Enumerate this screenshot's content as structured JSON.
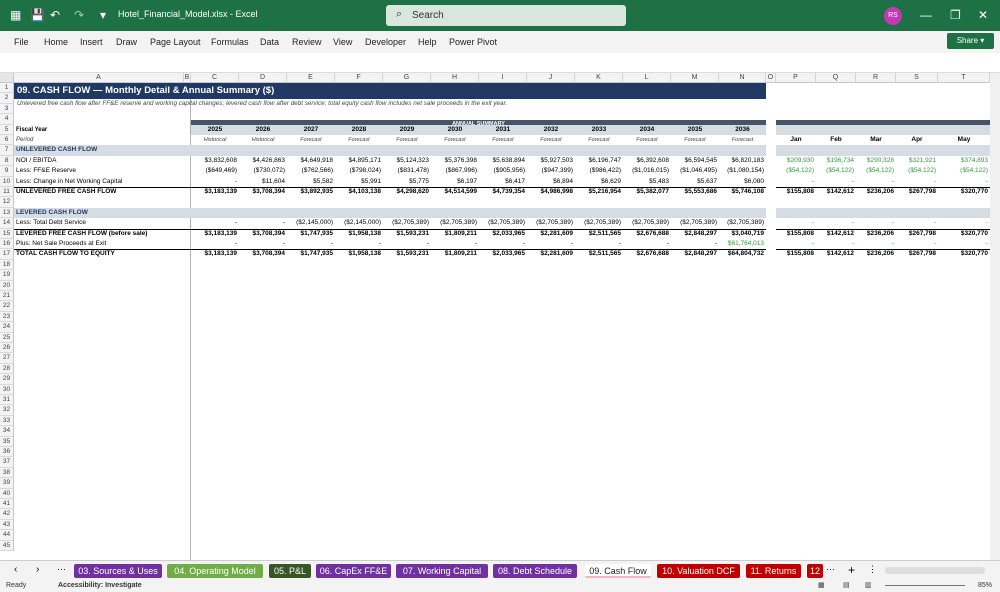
{
  "window": {
    "file_title": "Hotel_Financial_Model.xlsx  -  Excel",
    "search_placeholder": "Search",
    "avatar_initials": "RS"
  },
  "ribbon": {
    "menus": [
      "File",
      "Home",
      "Insert",
      "Draw",
      "Page Layout",
      "Formulas",
      "Data",
      "Review",
      "View",
      "Developer",
      "Help",
      "Power Pivot"
    ],
    "share_label": "Share"
  },
  "columns": [
    "A",
    "B",
    "C",
    "D",
    "E",
    "F",
    "G",
    "H",
    "I",
    "J",
    "K",
    "L",
    "M",
    "N",
    "O",
    "P",
    "Q",
    "R",
    "S",
    "T"
  ],
  "rows": [
    "1",
    "2",
    "3",
    "4",
    "5",
    "6",
    "7",
    "8",
    "9",
    "10",
    "11",
    "12",
    "13",
    "14",
    "15",
    "16",
    "17",
    "18",
    "19",
    "20",
    "21",
    "22",
    "23",
    "24",
    "25",
    "26",
    "27",
    "28",
    "29",
    "30",
    "31",
    "32",
    "33",
    "34",
    "35",
    "36",
    "37",
    "38",
    "39",
    "40",
    "41",
    "42",
    "43",
    "44",
    "45"
  ],
  "sheet": {
    "title": "09. CASH FLOW — Monthly Detail & Annual Summary ($)",
    "subtitle": "Unlevered free cash flow after FF&E reserve and working capital changes; levered cash flow after debt service; total equity cash flow includes net sale proceeds in the exit year.",
    "annual_summary_label": "ANNUAL SUMMARY",
    "fiscal_year_label": "Fiscal Year",
    "period_label": "Period",
    "years": [
      "2025",
      "2026",
      "2027",
      "2028",
      "2029",
      "2030",
      "2031",
      "2032",
      "2033",
      "2034",
      "2035",
      "2036"
    ],
    "periods": [
      "Historical",
      "Historical",
      "Forecast",
      "Forecast",
      "Forecast",
      "Forecast",
      "Forecast",
      "Forecast",
      "Forecast",
      "Forecast",
      "Forecast",
      "Forecast"
    ],
    "months": [
      "Jan",
      "Feb",
      "Mar",
      "Apr",
      "May"
    ],
    "section_unlevered": "UNLEVERED CASH FLOW",
    "section_levered": "LEVERED CASH FLOW",
    "lines": [
      {
        "row": 8,
        "label": "NOI / EBITDA",
        "bold": false,
        "values": [
          "$3,832,608",
          "$4,426,863",
          "$4,649,918",
          "$4,895,171",
          "$5,124,323",
          "$5,376,398",
          "$5,638,894",
          "$5,927,503",
          "$6,196,747",
          "$6,392,608",
          "$6,594,545",
          "$6,820,183"
        ],
        "monthly": [
          "$209,930",
          "$196,734",
          "$290,328",
          "$321,921",
          "$374,893"
        ]
      },
      {
        "row": 9,
        "label": "Less: FF&E Reserve",
        "bold": false,
        "values": [
          "($649,469)",
          "($730,072)",
          "($762,566)",
          "($798,024)",
          "($831,478)",
          "($867,996)",
          "($905,956)",
          "($947,399)",
          "($986,422)",
          "($1,016,015)",
          "($1,046,495)",
          "($1,080,154)"
        ],
        "monthly": [
          "($54,122)",
          "($54,122)",
          "($54,122)",
          "($54,122)",
          "($54,122)"
        ]
      },
      {
        "row": 10,
        "label": "Less: Change in Net Working Capital",
        "bold": false,
        "values": [
          "-",
          "$11,604",
          "$5,582",
          "$5,991",
          "$5,775",
          "$6,197",
          "$6,417",
          "$6,894",
          "$6,629",
          "$5,483",
          "$5,637",
          "$6,080"
        ],
        "monthly": [
          "-",
          "-",
          "-",
          "-",
          "-"
        ]
      },
      {
        "row": 11,
        "label": "UNLEVERED FREE CASH FLOW",
        "bold": true,
        "values": [
          "$3,183,139",
          "$3,708,394",
          "$3,892,935",
          "$4,103,138",
          "$4,298,620",
          "$4,514,599",
          "$4,739,354",
          "$4,986,998",
          "$5,216,954",
          "$5,382,077",
          "$5,553,686",
          "$5,746,108"
        ],
        "monthly": [
          "$155,808",
          "$142,612",
          "$236,206",
          "$267,798",
          "$320,770"
        ]
      },
      {
        "row": 14,
        "label": "Less: Total Debt Service",
        "bold": false,
        "values": [
          "-",
          "-",
          "($2,145,000)",
          "($2,145,000)",
          "($2,705,389)",
          "($2,705,389)",
          "($2,705,389)",
          "($2,705,389)",
          "($2,705,389)",
          "($2,705,389)",
          "($2,705,389)",
          "($2,705,389)"
        ],
        "monthly": [
          "-",
          "-",
          "-",
          "-",
          "-"
        ]
      },
      {
        "row": 15,
        "label": "LEVERED FREE CASH FLOW (before sale)",
        "bold": true,
        "values": [
          "$3,183,139",
          "$3,708,394",
          "$1,747,935",
          "$1,958,138",
          "$1,593,231",
          "$1,809,211",
          "$2,033,965",
          "$2,281,609",
          "$2,511,565",
          "$2,676,688",
          "$2,848,297",
          "$3,040,719"
        ],
        "monthly": [
          "$155,808",
          "$142,612",
          "$236,206",
          "$267,798",
          "$320,770"
        ]
      },
      {
        "row": 16,
        "label": "Plus: Net Sale Proceeds at Exit",
        "bold": false,
        "values": [
          "-",
          "-",
          "-",
          "-",
          "-",
          "-",
          "-",
          "-",
          "-",
          "-",
          "-",
          "$61,764,013"
        ],
        "monthly": [
          "-",
          "-",
          "-",
          "-",
          "-"
        ]
      },
      {
        "row": 17,
        "label": "TOTAL CASH FLOW TO EQUITY",
        "bold": true,
        "values": [
          "$3,183,139",
          "$3,708,394",
          "$1,747,935",
          "$1,958,138",
          "$1,593,231",
          "$1,809,211",
          "$2,033,965",
          "$2,281,609",
          "$2,511,565",
          "$2,676,688",
          "$2,848,297",
          "$64,804,732"
        ],
        "monthly": [
          "$155,808",
          "$142,612",
          "$236,206",
          "$267,798",
          "$320,770"
        ]
      }
    ]
  },
  "tabs": [
    {
      "label": "03. Sources & Uses",
      "color": "#7030a0"
    },
    {
      "label": "04. Operating Model",
      "color": "#70ad47"
    },
    {
      "label": "05. P&L",
      "color": "#375623"
    },
    {
      "label": "06. CapEx FF&E",
      "color": "#7030a0"
    },
    {
      "label": "07. Working Capital",
      "color": "#7030a0"
    },
    {
      "label": "08. Debt Schedule",
      "color": "#7030a0"
    },
    {
      "label": "09. Cash Flow",
      "color": "#f4b6c2",
      "active": true
    },
    {
      "label": "10. Valuation DCF",
      "color": "#c00000"
    },
    {
      "label": "11. Returns",
      "color": "#c00000"
    },
    {
      "label": "12",
      "color": "#c00000"
    }
  ],
  "status": {
    "ready": "Ready",
    "accessibility": "Accessibility: Investigate",
    "zoom": "85%"
  }
}
